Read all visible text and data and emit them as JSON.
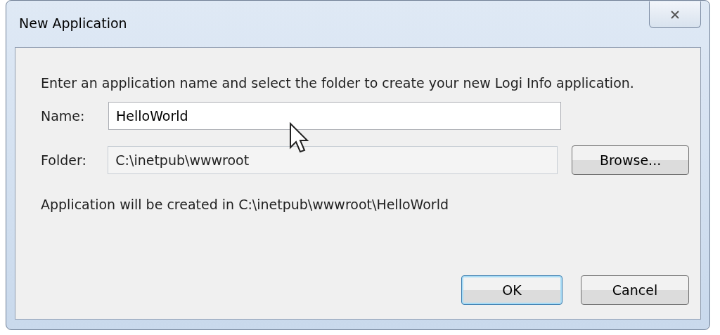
{
  "window": {
    "title": "New Application"
  },
  "instructions": "Enter an application name and select the folder to create your new Logi Info application.",
  "fields": [
    {
      "label": "Name:",
      "value": "HelloWorld",
      "disabled": false
    },
    {
      "label": "Folder:",
      "value": "C:\\inetpub\\wwwroot",
      "disabled": true,
      "button": "Browse..."
    }
  ],
  "result": "Application will be created in C:\\inetpub\\wwwroot\\HelloWorld",
  "buttons": [
    {
      "label": "OK",
      "default": true
    },
    {
      "label": "Cancel",
      "default": false
    }
  ]
}
